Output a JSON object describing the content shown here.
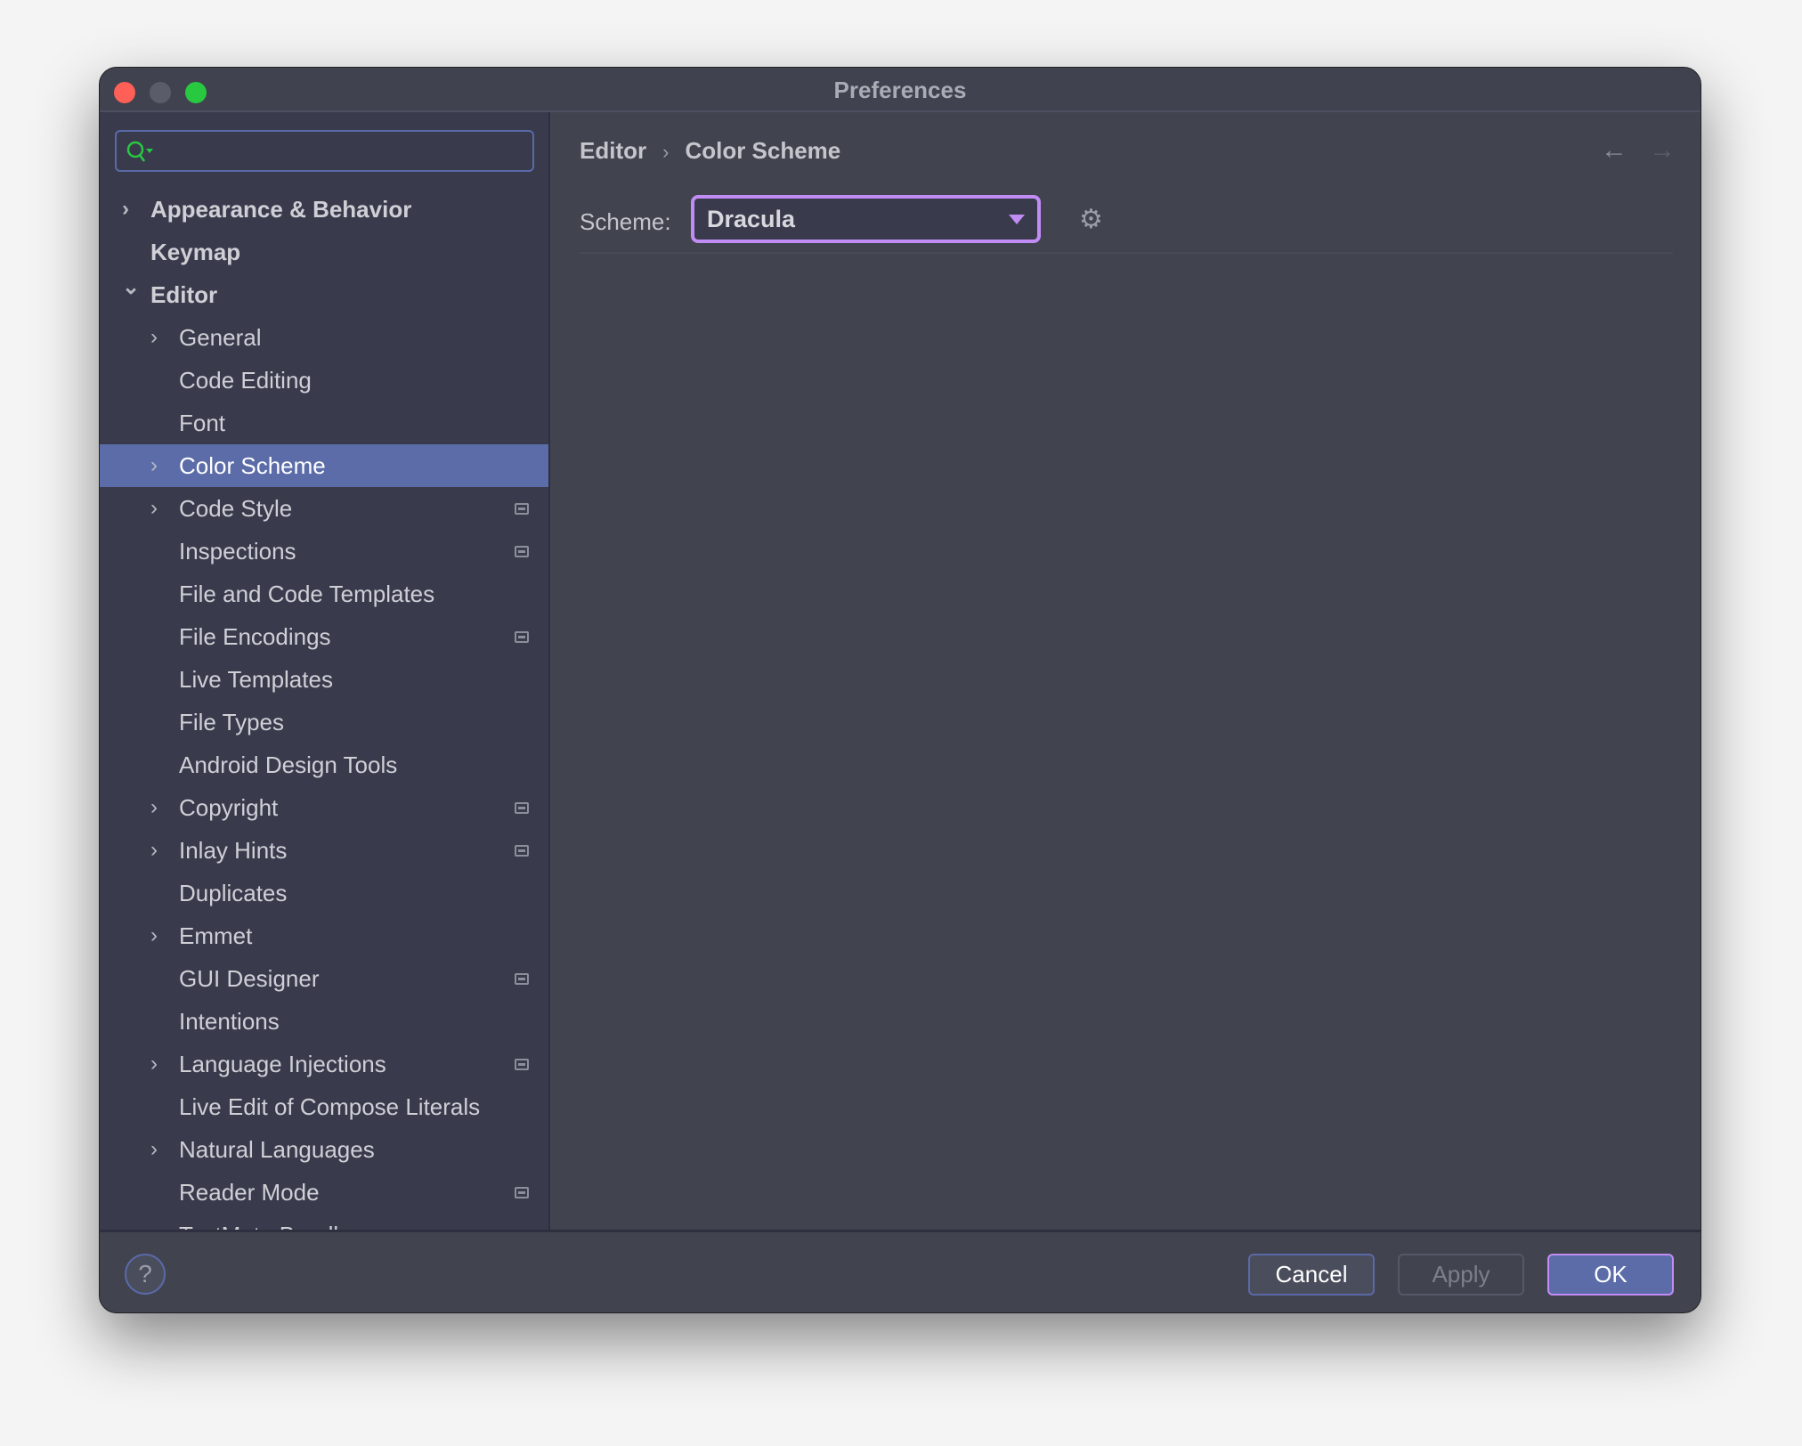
{
  "window": {
    "title": "Preferences"
  },
  "search": {
    "placeholder": "",
    "value": ""
  },
  "sidebar": {
    "items": [
      {
        "label": "Appearance & Behavior",
        "level": 0,
        "expander": "collapsed",
        "project": false
      },
      {
        "label": "Keymap",
        "level": 0,
        "expander": "none",
        "project": false
      },
      {
        "label": "Editor",
        "level": 0,
        "expander": "expanded",
        "project": false
      },
      {
        "label": "General",
        "level": 1,
        "expander": "collapsed",
        "project": false
      },
      {
        "label": "Code Editing",
        "level": 1,
        "expander": "none",
        "project": false
      },
      {
        "label": "Font",
        "level": 1,
        "expander": "none",
        "project": false
      },
      {
        "label": "Color Scheme",
        "level": 1,
        "expander": "collapsed",
        "project": false,
        "selected": true
      },
      {
        "label": "Code Style",
        "level": 1,
        "expander": "collapsed",
        "project": true
      },
      {
        "label": "Inspections",
        "level": 1,
        "expander": "none",
        "project": true
      },
      {
        "label": "File and Code Templates",
        "level": 1,
        "expander": "none",
        "project": false
      },
      {
        "label": "File Encodings",
        "level": 1,
        "expander": "none",
        "project": true
      },
      {
        "label": "Live Templates",
        "level": 1,
        "expander": "none",
        "project": false
      },
      {
        "label": "File Types",
        "level": 1,
        "expander": "none",
        "project": false
      },
      {
        "label": "Android Design Tools",
        "level": 1,
        "expander": "none",
        "project": false
      },
      {
        "label": "Copyright",
        "level": 1,
        "expander": "collapsed",
        "project": true
      },
      {
        "label": "Inlay Hints",
        "level": 1,
        "expander": "collapsed",
        "project": true
      },
      {
        "label": "Duplicates",
        "level": 1,
        "expander": "none",
        "project": false
      },
      {
        "label": "Emmet",
        "level": 1,
        "expander": "collapsed",
        "project": false
      },
      {
        "label": "GUI Designer",
        "level": 1,
        "expander": "none",
        "project": true
      },
      {
        "label": "Intentions",
        "level": 1,
        "expander": "none",
        "project": false
      },
      {
        "label": "Language Injections",
        "level": 1,
        "expander": "collapsed",
        "project": true
      },
      {
        "label": "Live Edit of Compose Literals",
        "level": 1,
        "expander": "none",
        "project": false
      },
      {
        "label": "Natural Languages",
        "level": 1,
        "expander": "collapsed",
        "project": false
      },
      {
        "label": "Reader Mode",
        "level": 1,
        "expander": "none",
        "project": true
      },
      {
        "label": "TextMate Bundles",
        "level": 1,
        "expander": "none",
        "project": false
      }
    ]
  },
  "breadcrumb": {
    "parent": "Editor",
    "separator": "›",
    "current": "Color Scheme"
  },
  "scheme": {
    "label": "Scheme:",
    "value": "Dracula"
  },
  "footer": {
    "help": "?",
    "cancel": "Cancel",
    "apply": "Apply",
    "ok": "OK"
  },
  "colors": {
    "accent": "#c28cf5",
    "selection": "#5b6ca8",
    "close": "#fe5f57",
    "minimize": "#5a5c6a",
    "zoom": "#28c840"
  }
}
